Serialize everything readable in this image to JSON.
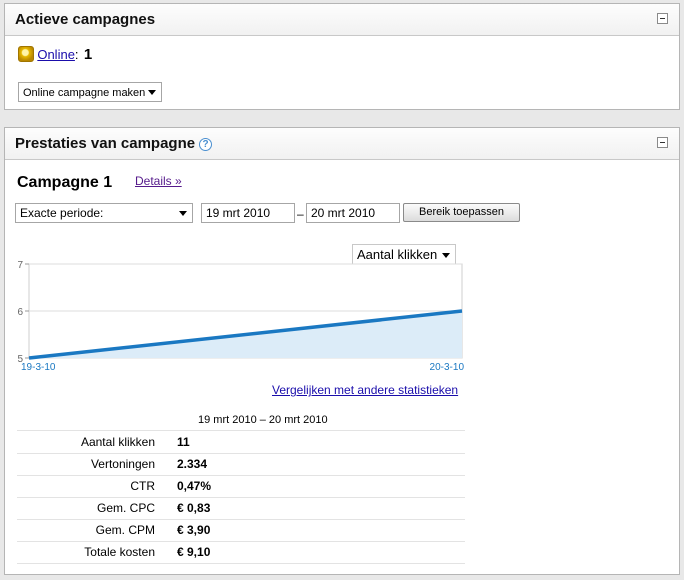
{
  "active_panel": {
    "title": "Actieve campagnes",
    "status_link": "Online",
    "status_separator": ":",
    "status_count": "1",
    "create_select": "Online campagne maken"
  },
  "performance_panel": {
    "title": "Prestaties van campagne",
    "campaign_name": "Campagne 1",
    "details_link": "Details »",
    "period_select": "Exacte periode:",
    "date_from": "19 mrt 2010",
    "date_separator": "–",
    "date_to": "20 mrt 2010",
    "apply_button": "Bereik toepassen",
    "metric_select": "Aantal klikken",
    "compare_link": "Vergelijken met andere statistieken",
    "range_label": "19 mrt 2010 – 20 mrt 2010",
    "stats": [
      {
        "label": "Aantal klikken",
        "value": "11"
      },
      {
        "label": "Vertoningen",
        "value": "2.334"
      },
      {
        "label": "CTR",
        "value": "0,47%"
      },
      {
        "label": "Gem. CPC",
        "value": "€ 0,83"
      },
      {
        "label": "Gem. CPM",
        "value": "€ 3,90"
      },
      {
        "label": "Totale kosten",
        "value": "€ 9,10"
      }
    ]
  },
  "chart_data": {
    "type": "area",
    "x": [
      "19-3-10",
      "20-3-10"
    ],
    "series": [
      {
        "values": [
          5,
          6
        ]
      }
    ],
    "yticks": [
      "5",
      "6",
      "7"
    ],
    "ylim": [
      5,
      7
    ],
    "x_tick_labels": [
      "19-3-10",
      "20-3-10"
    ],
    "line_color": "#1a78c2",
    "fill_color": "#dcecf8",
    "grid": true
  }
}
